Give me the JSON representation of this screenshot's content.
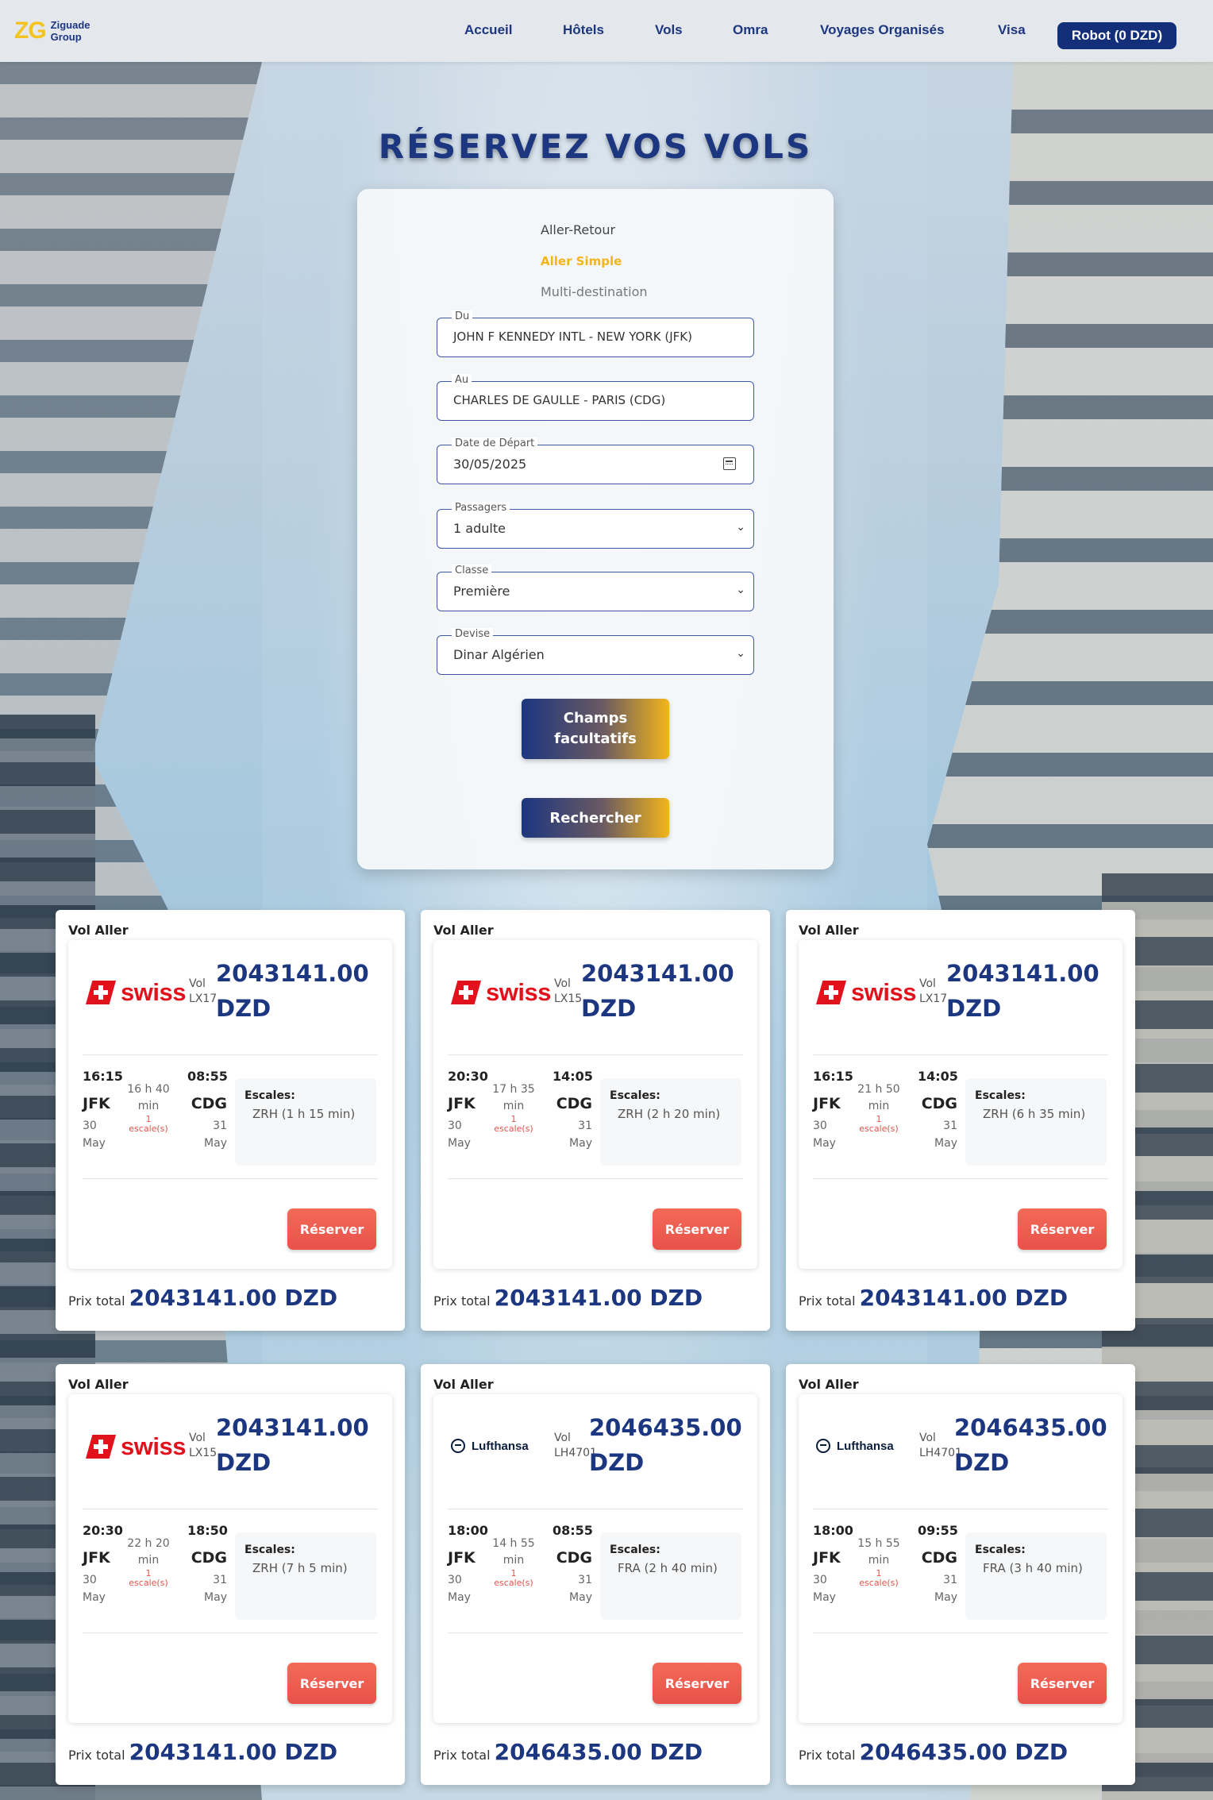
{
  "nav": {
    "logo_mark": "ZG",
    "logo_text": "Ziguade Group",
    "links": [
      "Accueil",
      "Hôtels",
      "Vols",
      "Omra",
      "Voyages Organisés",
      "Visa"
    ],
    "robot_button": "Robot (0 DZD)"
  },
  "page_title": "RÉSERVEZ VOS VOLS",
  "search": {
    "trip_types": [
      "Aller-Retour",
      "Aller Simple",
      "Multi-destination"
    ],
    "active_trip_type": "Aller Simple",
    "from": {
      "label": "Du",
      "value": "JOHN F KENNEDY INTL - NEW YORK (JFK)"
    },
    "to": {
      "label": "Au",
      "value": "CHARLES DE GAULLE - PARIS (CDG)"
    },
    "date": {
      "label": "Date de Départ",
      "value": "30/05/2025"
    },
    "passengers": {
      "label": "Passagers",
      "value": "1 adulte"
    },
    "class": {
      "label": "Classe",
      "value": "Première"
    },
    "currency": {
      "label": "Devise",
      "value": "Dinar Algérien"
    },
    "optional_button": "Champs facultatifs",
    "search_button": "Rechercher"
  },
  "results_common": {
    "heading": "Vol Aller",
    "vol_label": "Vol",
    "escales_label": "Escales:",
    "reserve_button": "Réserver",
    "total_label": "Prix total"
  },
  "results": [
    {
      "airline": "swiss",
      "flight": "LX17",
      "price": "2043141.00",
      "currency": "DZD",
      "dep_time": "16:15",
      "dep_code": "JFK",
      "dep_day": "30",
      "dep_month": "May",
      "duration": "16 h 40 min",
      "stops": "1",
      "stops_label": "escale(s)",
      "arr_time": "08:55",
      "arr_code": "CDG",
      "arr_day": "31",
      "arr_month": "May",
      "escale": "ZRH (1 h 15 min)",
      "total": "2043141.00 DZD"
    },
    {
      "airline": "swiss",
      "flight": "LX15",
      "price": "2043141.00",
      "currency": "DZD",
      "dep_time": "20:30",
      "dep_code": "JFK",
      "dep_day": "30",
      "dep_month": "May",
      "duration": "17 h 35 min",
      "stops": "1",
      "stops_label": "escale(s)",
      "arr_time": "14:05",
      "arr_code": "CDG",
      "arr_day": "31",
      "arr_month": "May",
      "escale": "ZRH (2 h 20 min)",
      "total": "2043141.00 DZD"
    },
    {
      "airline": "swiss",
      "flight": "LX17",
      "price": "2043141.00",
      "currency": "DZD",
      "dep_time": "16:15",
      "dep_code": "JFK",
      "dep_day": "30",
      "dep_month": "May",
      "duration": "21 h 50 min",
      "stops": "1",
      "stops_label": "escale(s)",
      "arr_time": "14:05",
      "arr_code": "CDG",
      "arr_day": "31",
      "arr_month": "May",
      "escale": "ZRH (6 h 35 min)",
      "total": "2043141.00 DZD"
    },
    {
      "airline": "swiss",
      "flight": "LX15",
      "price": "2043141.00",
      "currency": "DZD",
      "dep_time": "20:30",
      "dep_code": "JFK",
      "dep_day": "30",
      "dep_month": "May",
      "duration": "22 h 20 min",
      "stops": "1",
      "stops_label": "escale(s)",
      "arr_time": "18:50",
      "arr_code": "CDG",
      "arr_day": "31",
      "arr_month": "May",
      "escale": "ZRH (7 h 5 min)",
      "total": "2043141.00 DZD"
    },
    {
      "airline": "Lufthansa",
      "flight": "LH4701",
      "price": "2046435.00",
      "currency": "DZD",
      "dep_time": "18:00",
      "dep_code": "JFK",
      "dep_day": "30",
      "dep_month": "May",
      "duration": "14 h 55 min",
      "stops": "1",
      "stops_label": "escale(s)",
      "arr_time": "08:55",
      "arr_code": "CDG",
      "arr_day": "31",
      "arr_month": "May",
      "escale": "FRA (2 h 40 min)",
      "total": "2046435.00 DZD"
    },
    {
      "airline": "Lufthansa",
      "flight": "LH4701",
      "price": "2046435.00",
      "currency": "DZD",
      "dep_time": "18:00",
      "dep_code": "JFK",
      "dep_day": "30",
      "dep_month": "May",
      "duration": "15 h 55 min",
      "stops": "1",
      "stops_label": "escale(s)",
      "arr_time": "09:55",
      "arr_code": "CDG",
      "arr_day": "31",
      "arr_month": "May",
      "escale": "FRA (3 h 40 min)",
      "total": "2046435.00 DZD"
    }
  ],
  "colors": {
    "brand_navy": "#1c3680",
    "brand_gold": "#f2b51a",
    "reserve_red": "#e8524a",
    "swiss_red": "#e2121d"
  }
}
